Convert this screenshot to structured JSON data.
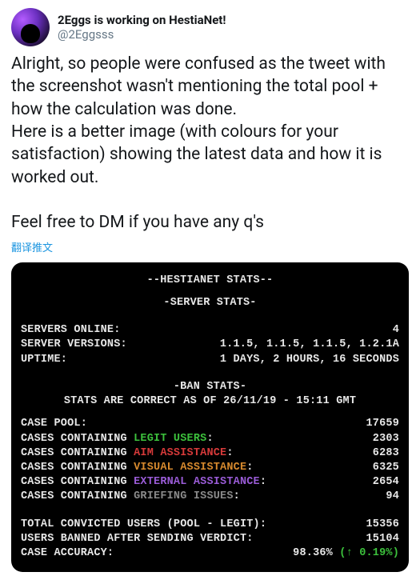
{
  "tweet": {
    "display_name": "2Eggs is working on HestiaNet!",
    "handle": "@2Eggsss",
    "text": "Alright, so people were confused as the tweet with the screenshot wasn't mentioning the total pool + how the calculation was done.\nHere is a better image (with colours for your satisfaction) showing the latest data and how it is worked out.\n\nFeel free to DM if you have any q's",
    "translate": "翻译推文"
  },
  "terminal": {
    "title": "--HESTIANET STATS--",
    "server_header": "-SERVER STATS-",
    "servers_online_label": "SERVERS ONLINE:",
    "servers_online_value": "4",
    "server_versions_label": "SERVER VERSIONS:",
    "server_versions_value": "1.1.5, 1.1.5, 1.1.5, 1.2.1A",
    "uptime_label": "UPTIME:",
    "uptime_value": "1 DAYS, 2 HOURS, 16 SECONDS",
    "ban_header": "-BAN STATS-",
    "correct_as_of": "STATS ARE CORRECT AS OF 26/11/19 - 15:11 GMT",
    "case_pool_label": "CASE POOL:",
    "case_pool_value": "17659",
    "cases_prefix": "CASES CONTAINING ",
    "legit_label": "LEGIT USERS",
    "legit_value": "2303",
    "aim_label": "AIM ASSISTANCE",
    "aim_value": "6283",
    "visual_label": "VISUAL ASSISTANCE",
    "visual_value": "6325",
    "external_label": "EXTERNAL ASSISTANCE",
    "external_value": "2654",
    "griefing_label": "GRIEFING ISSUES",
    "griefing_value": "94",
    "colon": ":",
    "convicted_label": "TOTAL CONVICTED USERS (POOL - LEGIT):",
    "convicted_value": "15356",
    "banned_label": "USERS BANNED AFTER SENDING VERDICT:",
    "banned_value": "15104",
    "accuracy_label": "CASE ACCURACY:",
    "accuracy_value": "98.36%",
    "accuracy_delta": " (↑ 0.19%)"
  }
}
